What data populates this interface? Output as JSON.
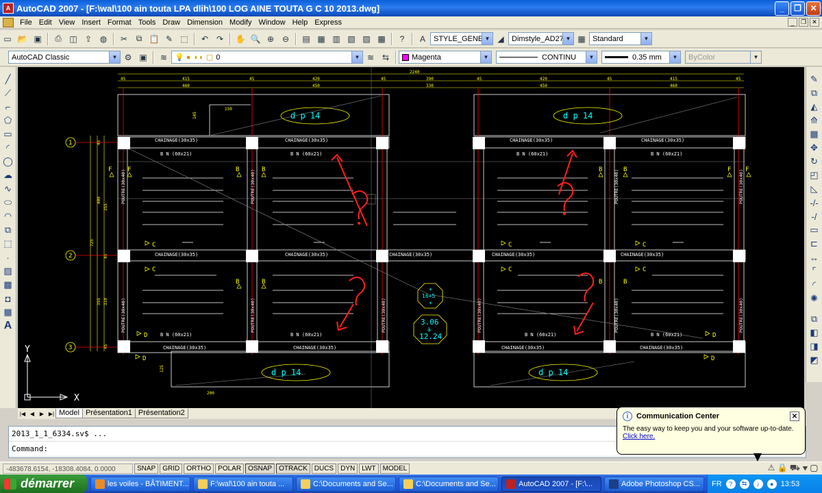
{
  "window": {
    "title": "AutoCAD 2007 - [F:\\wal\\100 ain touta LPA dlih\\100 LOG AINE TOUTA G C 10 2013.dwg]"
  },
  "menu": [
    "File",
    "Edit",
    "View",
    "Insert",
    "Format",
    "Tools",
    "Draw",
    "Dimension",
    "Modify",
    "Window",
    "Help",
    "Express"
  ],
  "toolbar1": {
    "textstyle": "STYLE_GENEF",
    "dimstyle": "Dimstyle_AD27",
    "tablestyle": "Standard"
  },
  "toolbar2": {
    "workspace": "AutoCAD Classic",
    "layer": "0",
    "color": "Magenta",
    "linetype": "CONTINU",
    "lineweight": "0.35 mm",
    "plotstyle": "ByColor"
  },
  "drawing": {
    "top_dim_total": "2240",
    "top_dims_row1": [
      "45",
      "415",
      "45",
      "420",
      "45",
      "390",
      "45",
      "420",
      "45",
      "415",
      "45"
    ],
    "top_dims_row2": [
      "460",
      "450",
      "330",
      "450",
      "460"
    ],
    "dim_150": "150",
    "dim_145": "145",
    "dim_200": "200",
    "dim_125": "125",
    "left_dims": [
      "45",
      "400",
      "355",
      "45",
      "725",
      "355",
      "310",
      "45"
    ],
    "axis_labels": [
      "1",
      "2",
      "3"
    ],
    "chainage_label": "CHAINAGE(30x35)",
    "bn_label": "B N (60x21)",
    "poutre_label": "POUTRE(30x40)",
    "dp_label": "d p 14",
    "label_b": "B",
    "label_c": "C",
    "label_d": "D",
    "label_f": "F",
    "tag1_top": "+",
    "tag1_mid": "16+5",
    "tag1_bot": "+",
    "tag2_top": "3.06",
    "tag2_mid": "à",
    "tag2_bot": "12.24",
    "ucs_x": "X",
    "ucs_y": "Y",
    "color_chainage": "#ffffff",
    "color_dim": "#ffff00",
    "color_cyan": "#00ffff",
    "color_red": "#ff0000"
  },
  "tabs": [
    "Model",
    "Présentation1",
    "Présentation2"
  ],
  "command": {
    "line1": "2013_1_1_6334.sv$ ...",
    "line2": "Command:"
  },
  "status": {
    "coords": "-483678.6154, -18308.4084, 0.0000",
    "buttons": [
      "SNAP",
      "GRID",
      "ORTHO",
      "POLAR",
      "OSNAP",
      "OTRACK",
      "DUCS",
      "DYN",
      "LWT",
      "MODEL"
    ]
  },
  "balloon": {
    "title": "Communication Center",
    "text": "The easy way to keep you and your software up-to-date.",
    "link": "Click here."
  },
  "taskbar": {
    "start": "démarrer",
    "tasks": [
      "les voiles - BÂTIMENT...",
      "F:\\wal\\100 ain touta ...",
      "C:\\Documents and Se...",
      "C:\\Documents and Se...",
      "AutoCAD 2007 - [F:\\...",
      "Adobe Photoshop CS..."
    ],
    "lang": "FR",
    "time": "13:53"
  }
}
